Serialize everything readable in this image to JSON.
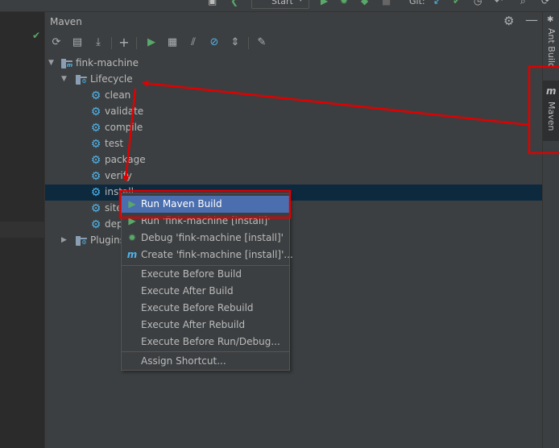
{
  "topbar": {
    "run_config": "Start",
    "vcs_label": "Git:"
  },
  "panel": {
    "title": "Maven",
    "header_icons": [
      "gear-icon",
      "minimize-icon"
    ],
    "toolbar_icons": [
      "reload-icon",
      "generate-sources-icon",
      "download-icon",
      "add-icon",
      "run-icon",
      "execute-goal-icon",
      "toggle-offline-icon",
      "skip-tests-icon",
      "collapse-all-icon",
      "settings-wrench-icon"
    ]
  },
  "tree": {
    "root": "fink-machine",
    "lifecycle": "Lifecycle",
    "goals": [
      "clean",
      "validate",
      "compile",
      "test",
      "package",
      "verify",
      "install",
      "site",
      "deploy"
    ],
    "selected_goal": "install",
    "plugins": "Plugins"
  },
  "right_tabs": {
    "ant": "Ant Build",
    "maven": "Maven",
    "maven_icon": "m"
  },
  "context_menu": {
    "items": [
      {
        "label": "Run Maven Build",
        "icon": "run-green-icon",
        "highlighted": true
      },
      {
        "label": "Run 'fink-machine [install]'",
        "icon": "run-green-icon"
      },
      {
        "label": "Debug 'fink-machine [install]'",
        "icon": "debug-bug-icon"
      },
      {
        "label": "Create 'fink-machine [install]'...",
        "icon": "maven-m-icon"
      }
    ],
    "group2": [
      "Execute Before Build",
      "Execute After Build",
      "Execute Before Rebuild",
      "Execute After Rebuild",
      "Execute Before Run/Debug..."
    ],
    "group3": [
      "Assign Shortcut..."
    ]
  },
  "colors": {
    "annotation_red": "#e00000",
    "highlight_blue": "#4b6eaf",
    "gear_blue": "#4fb3e8",
    "run_green": "#59a869"
  }
}
